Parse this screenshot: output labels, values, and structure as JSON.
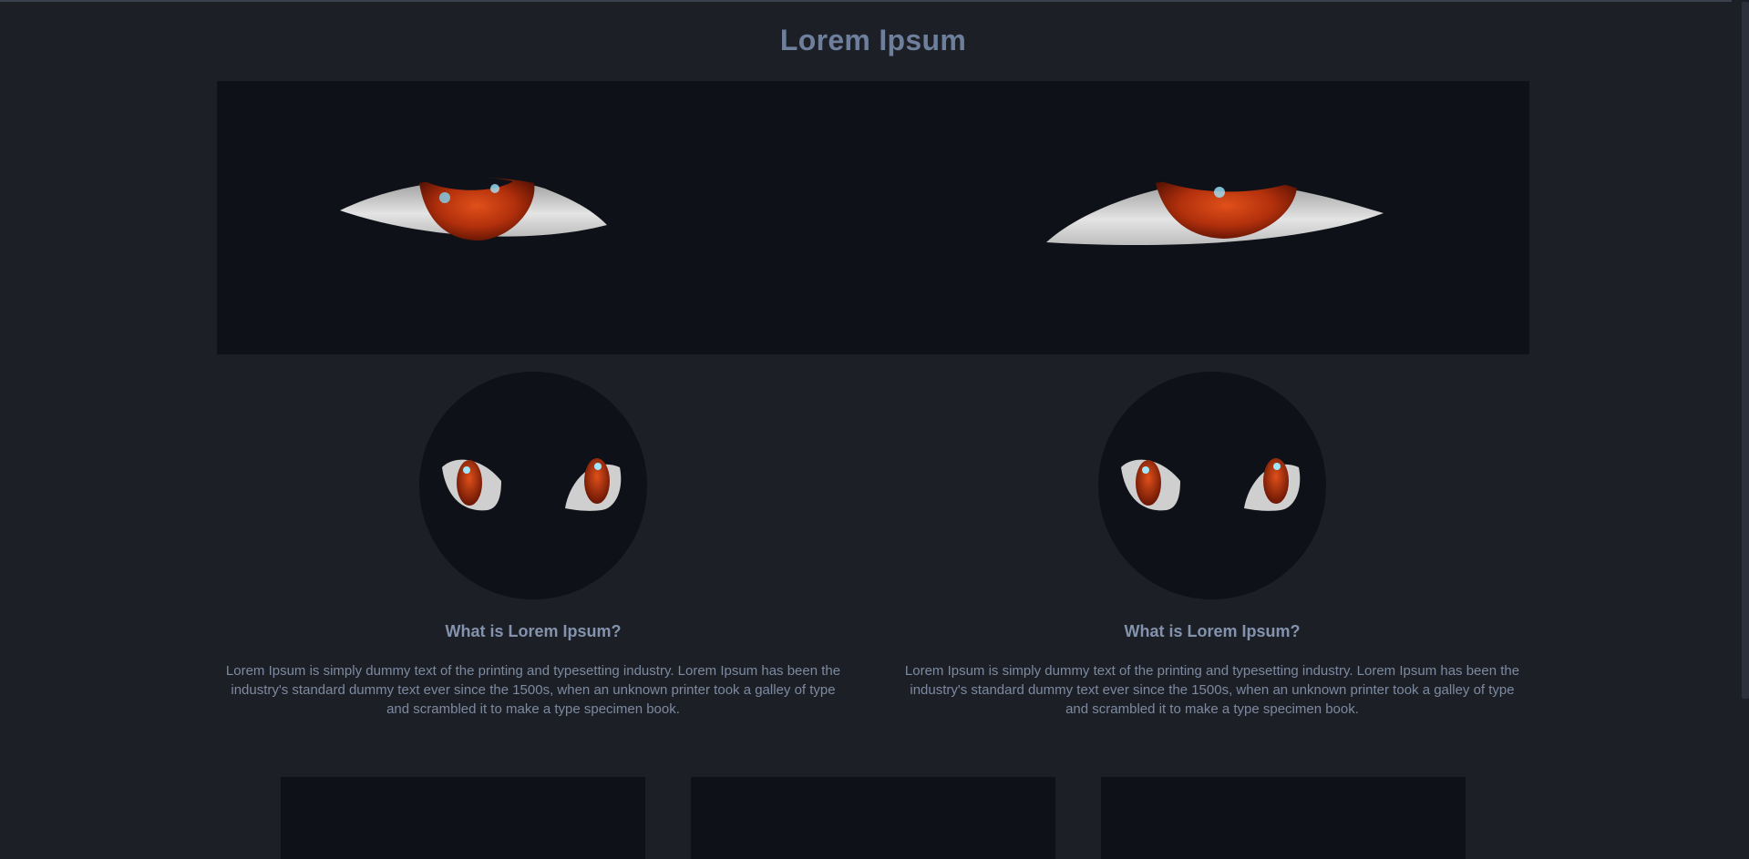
{
  "header": {
    "title": "Lorem Ipsum"
  },
  "hero": {
    "image_icon": "glowing-eyes-image"
  },
  "cards": [
    {
      "image_icon": "cartoon-eyes-image",
      "title": "What is Lorem Ipsum?",
      "text": "Lorem Ipsum is simply dummy text of the printing and typesetting industry. Lorem Ipsum has been the industry's standard dummy text ever since the 1500s, when an unknown printer took a galley of type and scrambled it to make a type specimen book."
    },
    {
      "image_icon": "cartoon-eyes-image",
      "title": "What is Lorem Ipsum?",
      "text": "Lorem Ipsum is simply dummy text of the printing and typesetting industry. Lorem Ipsum has been the industry's standard dummy text ever since the 1500s, when an unknown printer took a galley of type and scrambled it to make a type specimen book."
    }
  ],
  "colors": {
    "background": "#1c1f26",
    "panel": "#0e1117",
    "heading": "#6e7f9c",
    "text": "#7d8aa0",
    "iris": "#b2300c"
  }
}
